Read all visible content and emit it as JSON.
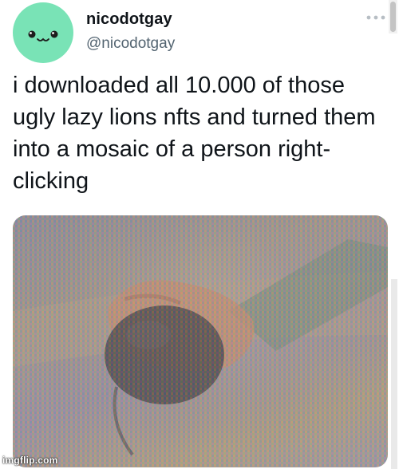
{
  "tweet": {
    "display_name": "nicodotgay",
    "handle": "@nicodotgay",
    "text": "i downloaded all 10.000 of those ugly lazy lions nfts and turned them into a mosaic of a person right-clicking",
    "avatar_color": "#79e3b6"
  },
  "icons": {
    "more": "more-horizontal-icon"
  },
  "watermark": "imgflip.com"
}
